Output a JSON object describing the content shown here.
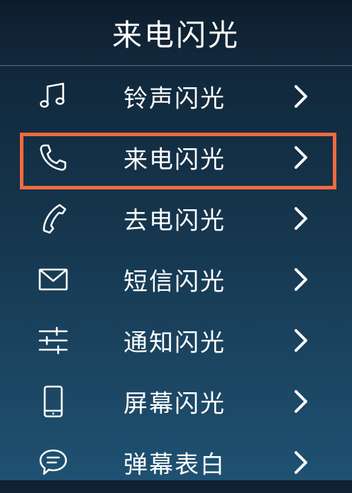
{
  "header": {
    "title": "来电闪光"
  },
  "menu": {
    "items": [
      {
        "label": "铃声闪光",
        "icon": "music-note-icon"
      },
      {
        "label": "来电闪光",
        "icon": "phone-icon"
      },
      {
        "label": "去电闪光",
        "icon": "phone-outgoing-icon"
      },
      {
        "label": "短信闪光",
        "icon": "envelope-icon"
      },
      {
        "label": "通知闪光",
        "icon": "sliders-icon"
      },
      {
        "label": "屏幕闪光",
        "icon": "smartphone-icon"
      },
      {
        "label": "弹幕表白",
        "icon": "chat-bubble-icon"
      }
    ]
  },
  "colors": {
    "highlight": "#f26b40",
    "background_top": "#0f2234",
    "background_bottom": "#1f5172"
  }
}
